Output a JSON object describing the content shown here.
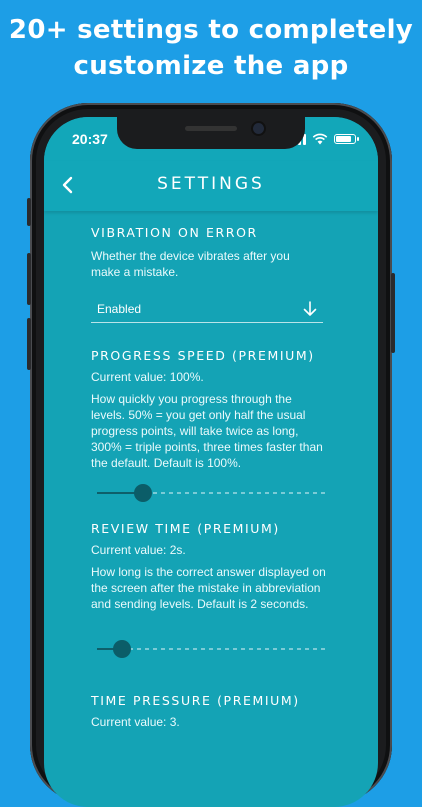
{
  "promo": {
    "line1": "20+ settings to completely",
    "line2": "customize the app"
  },
  "status": {
    "time": "20:37"
  },
  "nav": {
    "title": "SETTINGS"
  },
  "settings": {
    "vibration": {
      "title": "VIBRATION ON ERROR",
      "description": "Whether the device vibrates after you make a mistake.",
      "selected": "Enabled"
    },
    "progress_speed": {
      "title": "PROGRESS SPEED (PREMIUM)",
      "current": "Current value: 100%.",
      "description": "How quickly you progress through the levels. 50% = you get only half the usual progress points, will take twice as long, 300% = triple points, three times faster than the default. Default is 100%.",
      "slider_fraction": 0.2
    },
    "review_time": {
      "title": "REVIEW TIME (PREMIUM)",
      "current": "Current value: 2s.",
      "description": "How long is the correct answer displayed on the screen after the mistake in abbreviation and sending levels. Default is 2 seconds.",
      "slider_fraction": 0.11
    },
    "time_pressure": {
      "title": "TIME PRESSURE (PREMIUM)",
      "current": "Current value: 3."
    }
  },
  "colors": {
    "background": "#1d9ee6",
    "screen": "#14a3b5",
    "thumb": "#0b5d68"
  }
}
